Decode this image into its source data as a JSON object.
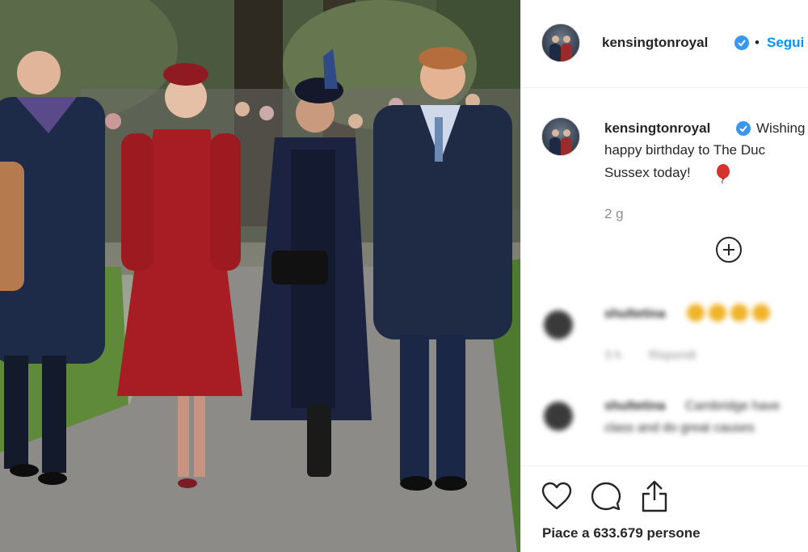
{
  "post": {
    "author": "kensingtonroyal",
    "follow_label": "Segui",
    "separator": "•",
    "caption_lines": [
      "Wishing",
      "happy birthday to The Duc",
      "Sussex today!"
    ],
    "caption_emoji": "balloon",
    "timestamp": "2 g",
    "likes_text": "Piace a 633.679 persone"
  },
  "comments": [
    {
      "user": "shultetina",
      "text": "",
      "emoji_count": 4,
      "time": "3 h",
      "reply_label": "Rispondi"
    },
    {
      "user": "shultetina",
      "text": "Cambridge have",
      "text_line2": "class and do great causes"
    }
  ],
  "icons": {
    "verified": "verified-badge-icon",
    "load_more": "plus-circle-icon",
    "like": "heart-icon",
    "comment": "comment-bubble-icon",
    "share": "share-icon"
  },
  "colors": {
    "link_blue": "#0095f6",
    "verified_blue": "#3897f0",
    "text": "#262626",
    "muted": "#8e8e8e",
    "divider": "#efefef"
  }
}
